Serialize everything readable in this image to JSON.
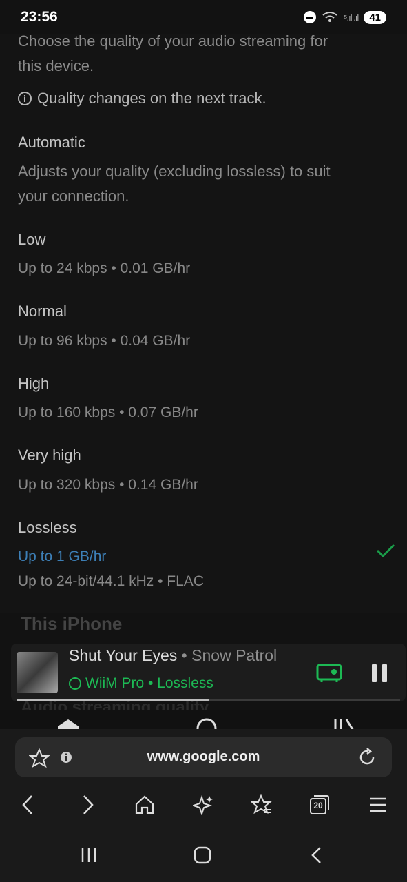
{
  "status": {
    "time": "23:56",
    "battery": "41",
    "signal": "⁵.ıl .ıl"
  },
  "settings": {
    "description": [
      "Choose the quality of your audio streaming for",
      "this device."
    ],
    "notice": "Quality changes on the next track.",
    "options": [
      {
        "title": "Automatic",
        "lines": [
          "Adjusts your quality (excluding lossless) to suit",
          "your connection."
        ]
      },
      {
        "title": "Low",
        "lines": [
          "Up to 24 kbps • 0.01 GB/hr"
        ]
      },
      {
        "title": "Normal",
        "lines": [
          "Up to 96 kbps • 0.04 GB/hr"
        ]
      },
      {
        "title": "High",
        "lines": [
          "Up to 160 kbps • 0.07 GB/hr"
        ]
      },
      {
        "title": "Very high",
        "lines": [
          "Up to 320 kbps • 0.14 GB/hr"
        ]
      },
      {
        "title": "Lossless",
        "link": "Up to 1 GB/hr",
        "lines": [
          "Up to 24-bit/44.1 kHz • FLAC"
        ],
        "selected": true
      }
    ],
    "next_section": "This iPhone",
    "next_section2": "Audio streaming quality"
  },
  "player": {
    "title": "Shut Your Eyes",
    "separator": " • ",
    "artist": "Snow Patrol",
    "device": "WiiM Pro • Lossless",
    "progress": 0.5
  },
  "browser": {
    "url": "www.google.com",
    "tab_count": "20"
  },
  "colors": {
    "accent": "#1db954",
    "link": "#3d7fb6"
  }
}
